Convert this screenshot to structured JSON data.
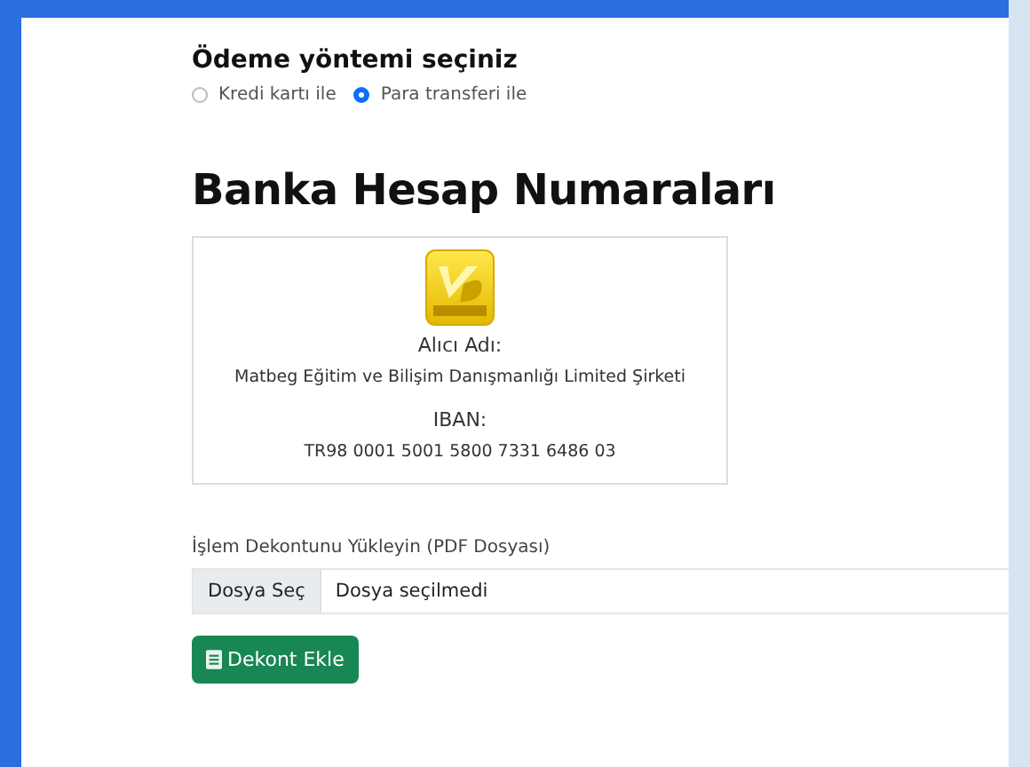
{
  "payment": {
    "heading": "Ödeme yöntemi seçiniz",
    "options": [
      {
        "label": "Kredi kartı ile",
        "selected": false
      },
      {
        "label": "Para transferi ile",
        "selected": true
      }
    ]
  },
  "bank": {
    "title": "Banka Hesap Numaraları",
    "recipient_label": "Alıcı Adı:",
    "recipient": "Matbeg Eğitim ve Bilişim Danışmanlığı Limited Şirketi",
    "iban_label": "IBAN:",
    "iban": "TR98 0001 5001 5800 7331 6486 03"
  },
  "upload": {
    "label": "İşlem Dekontunu Yükleyin (PDF Dosyası)",
    "button": "Dosya Seç",
    "value": "Dosya seçilmedi"
  },
  "submit": {
    "label": "Dekont Ekle"
  }
}
